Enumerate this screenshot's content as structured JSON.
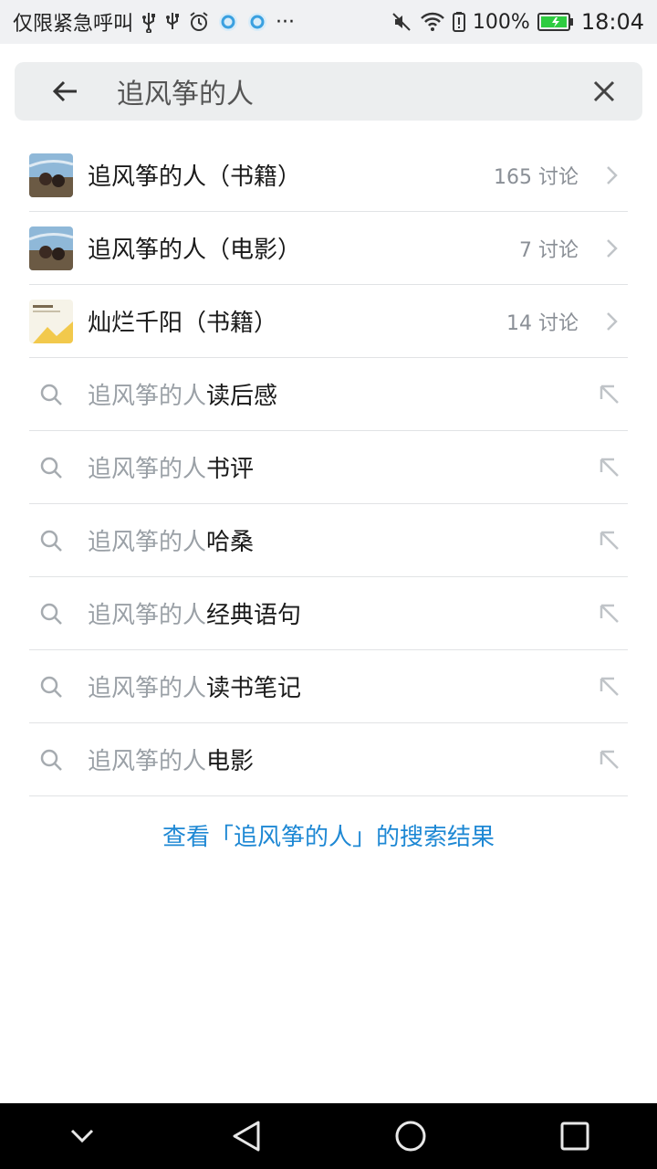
{
  "status_bar": {
    "carrier_text": "仅限紧急呼叫",
    "battery_percent": "100%",
    "time": "18:04",
    "overflow_glyph": "···",
    "icons": [
      "usb-icon",
      "usb-icon",
      "alarm-icon",
      "app-notification-icon",
      "app-notification-icon",
      "mute-icon",
      "wifi-icon",
      "battery-alert-icon",
      "battery-icon"
    ]
  },
  "search": {
    "query": "追风筝的人",
    "placeholder": "追风筝的人"
  },
  "topics": [
    {
      "title": "追风筝的人（书籍）",
      "meta": "165 讨论",
      "thumb": "kite-runner-cover"
    },
    {
      "title": "追风筝的人（电影）",
      "meta": "7 讨论",
      "thumb": "kite-runner-cover"
    },
    {
      "title": "灿烂千阳（书籍）",
      "meta": "14 讨论",
      "thumb": "splendid-suns-cover"
    }
  ],
  "suggestions": [
    {
      "prefix": "追风筝的人",
      "suffix": "读后感"
    },
    {
      "prefix": "追风筝的人",
      "suffix": "书评"
    },
    {
      "prefix": "追风筝的人",
      "suffix": "哈桑"
    },
    {
      "prefix": "追风筝的人",
      "suffix": "经典语句"
    },
    {
      "prefix": "追风筝的人",
      "suffix": "读书笔记"
    },
    {
      "prefix": "追风筝的人",
      "suffix": "电影"
    }
  ],
  "view_all": "查看「追风筝的人」的搜索结果",
  "colors": {
    "accent": "#1e88d4",
    "status_bg": "#f0f1f3",
    "search_bg": "#eceeef",
    "battery": "#2ecc40"
  }
}
